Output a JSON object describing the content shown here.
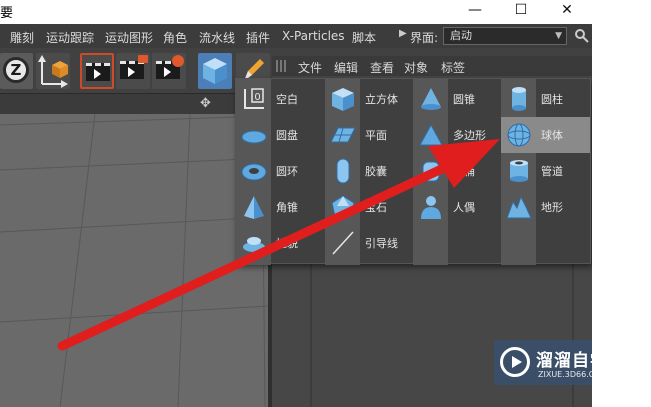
{
  "window": {
    "title": "要",
    "minimize": "—",
    "maximize": "☐",
    "close": "✕"
  },
  "menu": {
    "items": [
      "雕刻",
      "运动跟踪",
      "运动图形",
      "角色",
      "流水线",
      "插件",
      "X-Particles",
      "脚本"
    ],
    "layout_label": "界面:",
    "layout_value": "启动"
  },
  "object_manager": {
    "menu": [
      "文件",
      "编辑",
      "查看",
      "对象",
      "标签"
    ]
  },
  "primitives": {
    "col1": [
      "空白",
      "圆盘",
      "圆环",
      "角锥",
      "地貌"
    ],
    "col2": [
      "立方体",
      "平面",
      "胶囊",
      "宝石",
      "引导线"
    ],
    "col3": [
      "圆锥",
      "多边形",
      "油桶",
      "人偶"
    ],
    "col4": [
      "圆柱",
      "球体",
      "管道",
      "地形"
    ],
    "highlighted": "球体"
  },
  "watermark": {
    "name": "溜溜自学",
    "url": "ZIXUE.3D66.COM"
  },
  "colors": {
    "menu_bg": "#3c3c3c",
    "toolbar_bg": "#414141",
    "popup_bg": "#3f3f3f",
    "highlight": "#8a8a8a",
    "icon_blue": "#5fa9e0",
    "arrow_red": "#e01e1e",
    "active_tool": "#4c7fb7"
  }
}
